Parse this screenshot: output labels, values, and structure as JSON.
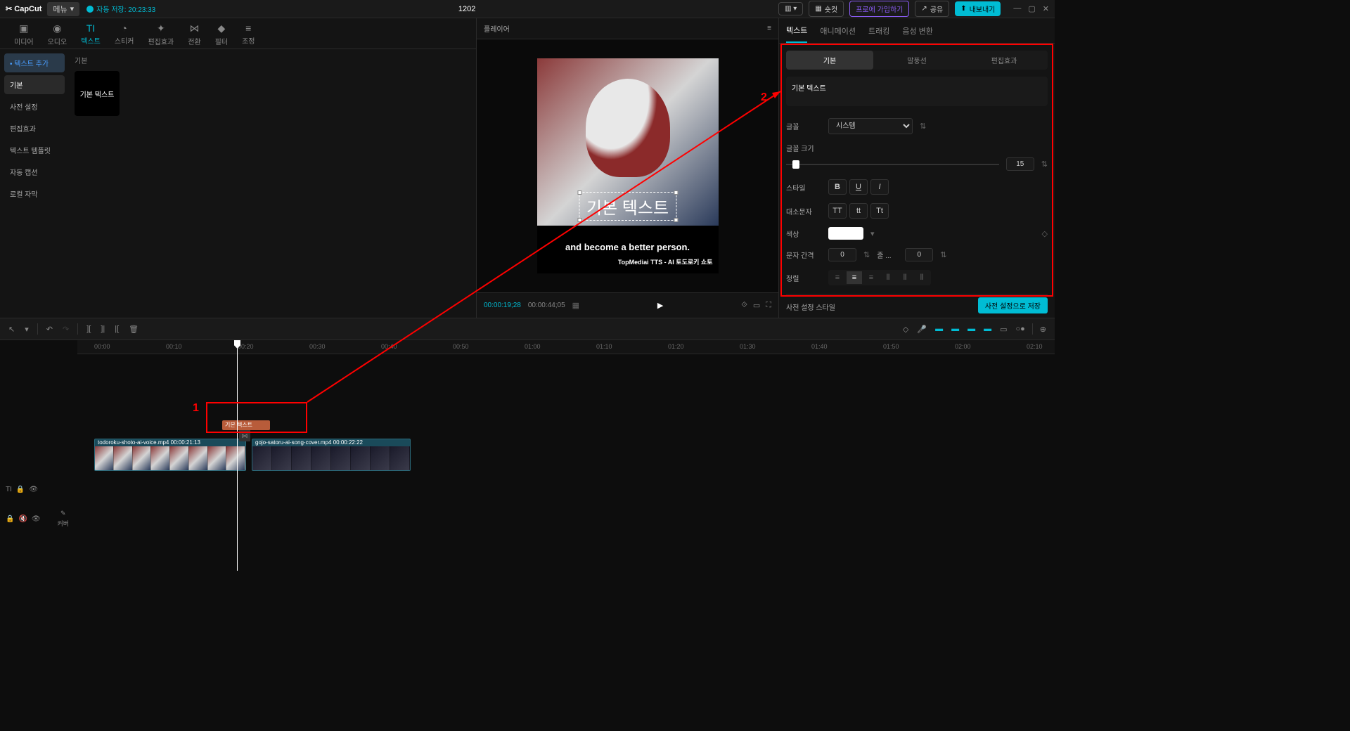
{
  "titlebar": {
    "logo": "✂ CapCut",
    "menu": "메뉴",
    "autosave": "자동 저장: 20:23:33",
    "project_name": "1202",
    "shortcut": "숏컷",
    "pro": "프로에 가입하기",
    "share": "공유",
    "export": "내보내기"
  },
  "media_tabs": [
    {
      "icon": "▣",
      "label": "미디어"
    },
    {
      "icon": "◉",
      "label": "오디오"
    },
    {
      "icon": "TI",
      "label": "텍스트"
    },
    {
      "icon": "◔",
      "label": "스티커"
    },
    {
      "icon": "✦",
      "label": "편집효과"
    },
    {
      "icon": "⋈",
      "label": "전환"
    },
    {
      "icon": "◆",
      "label": "필터"
    },
    {
      "icon": "≡",
      "label": "조정"
    }
  ],
  "sidebar": {
    "add": "• 텍스트 추가",
    "items": [
      "기본",
      "사전 설정",
      "편집효과",
      "텍스트 템플릿",
      "자동 캡션",
      "로컬 자막"
    ]
  },
  "content": {
    "section_label": "기본",
    "preset_label": "기본 텍스트"
  },
  "player": {
    "header": "플레이어",
    "text_overlay": "기본 텍스트",
    "subtitle": "and become a better person.",
    "credit": "TopMediai TTS - AI 토도로키 쇼토",
    "time_current": "00:00:19;28",
    "time_total": "00:00:44;05"
  },
  "right": {
    "tabs": [
      "텍스트",
      "애니메이션",
      "트래킹",
      "음성 변환"
    ],
    "sub_tabs": [
      "기본",
      "말풍선",
      "편집효과"
    ],
    "text_value": "기본 텍스트",
    "font_label": "글꼴",
    "font_value": "시스템",
    "size_label": "글꼴 크기",
    "size_value": "15",
    "style_label": "스타일",
    "case_label": "대소문자",
    "color_label": "색상",
    "spacing_label": "문자 간격",
    "spacing_value": "0",
    "line_label": "줄 ...",
    "line_value": "0",
    "align_label": "정렬",
    "preset_style_label": "사전 설정 스타일",
    "save_preset": "사전 설정으로 저장"
  },
  "timeline": {
    "ticks": [
      "00:00",
      "00:10",
      "00:20",
      "00:30",
      "00:40",
      "00:50",
      "01:00",
      "01:10",
      "01:20",
      "01:30",
      "01:40",
      "01:50",
      "02:00",
      "02:10"
    ],
    "text_clip": "기본 텍스트",
    "clip1_name": "todoroku-shoto-ai-voice.mp4",
    "clip1_time": "00:00:21:13",
    "clip2_name": "gojo-satoru-ai-song-cover.mp4",
    "clip2_time": "00:00:22:22",
    "cover_label": "커버"
  },
  "annotations": {
    "label1": "1",
    "label2": "2"
  }
}
